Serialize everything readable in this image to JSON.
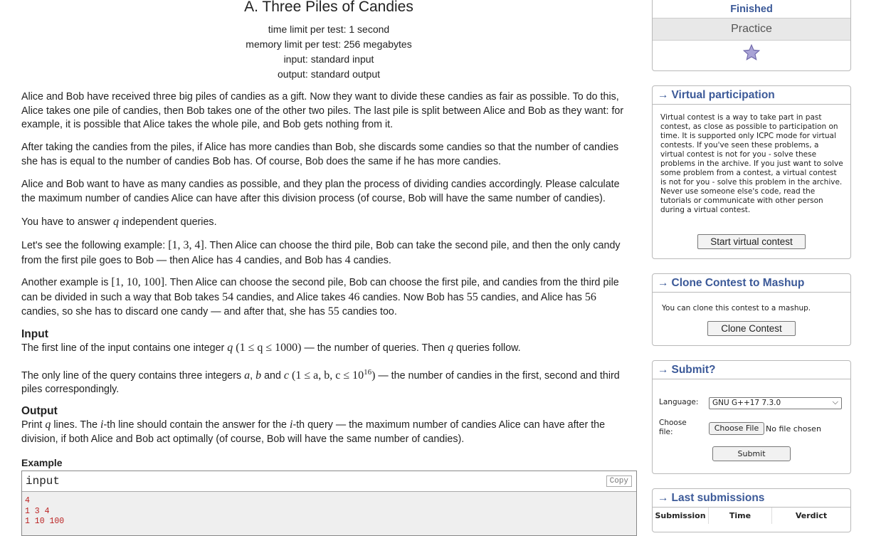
{
  "problem": {
    "title": "A. Three Piles of Candies",
    "limits": [
      "time limit per test: 1 second",
      "memory limit per test: 256 megabytes",
      "input: standard input",
      "output: standard output"
    ],
    "statement": {
      "p1": "Alice and Bob have received three big piles of candies as a gift. Now they want to divide these candies as fair as possible. To do this, Alice takes one pile of candies, then Bob takes one of the other two piles. The last pile is split between Alice and Bob as they want: for example, it is possible that Alice takes the whole pile, and Bob gets nothing from it.",
      "p2": "After taking the candies from the piles, if Alice has more candies than Bob, she discards some candies so that the number of candies she has is equal to the number of candies Bob has. Of course, Bob does the same if he has more candies.",
      "p3": "Alice and Bob want to have as many candies as possible, and they plan the process of dividing candies accordingly. Please calculate the maximum number of candies Alice can have after this division process (of course, Bob will have the same number of candies).",
      "p4_a": "You have to answer ",
      "p4_q": "q",
      "p4_b": " independent queries.",
      "p5_a": "Let's see the following example: ",
      "p5_m1": "[1, 3, 4]",
      "p5_b": ". Then Alice can choose the third pile, Bob can take the second pile, and then the only candy from the first pile goes to Bob — then Alice has ",
      "p5_m2": "4",
      "p5_c": " candies, and Bob has ",
      "p5_m3": "4",
      "p5_d": " candies.",
      "p6_a": "Another example is ",
      "p6_m1": "[1, 10, 100]",
      "p6_b": ". Then Alice can choose the second pile, Bob can choose the first pile, and candies from the third pile can be divided in such a way that Bob takes ",
      "p6_m2": "54",
      "p6_c": " candies, and Alice takes ",
      "p6_m3": "46",
      "p6_d": " candies. Now Bob has ",
      "p6_m4": "55",
      "p6_e": " candies, and Alice has ",
      "p6_m5": "56",
      "p6_f": " candies, so she has to discard one candy — and after that, she has ",
      "p6_m6": "55",
      "p6_g": " candies too."
    },
    "input": {
      "title": "Input",
      "l1_a": "The first line of the input contains one integer ",
      "l1_q": "q",
      "l1_m": "(1 ≤ q ≤ 1000)",
      "l1_b": " — the number of queries. Then ",
      "l1_q2": "q",
      "l1_c": " queries follow.",
      "l2_a": "The only line of the query contains three integers ",
      "l2_va": "a",
      "l2_sep1": ", ",
      "l2_vb": "b",
      "l2_and": " and ",
      "l2_vc": "c",
      "l2_m": "(1 ≤ a, b, c ≤ 10",
      "l2_exp": "16",
      "l2_close": ")",
      "l2_b": " — the number of candies in the first, second and third piles correspondingly."
    },
    "output": {
      "title": "Output",
      "a": "Print ",
      "q": "q",
      "b": " lines. The ",
      "i1": "i",
      "c": "-th line should contain the answer for the ",
      "i2": "i",
      "d": "-th query — the maximum number of candies Alice can have after the division, if both Alice and Bob act optimally (of course, Bob will have the same number of candies)."
    },
    "example": {
      "title": "Example",
      "input_label": "input",
      "copy_label": "Copy",
      "lines": [
        "4",
        "1 3 4",
        "1 10 100"
      ]
    }
  },
  "sidebar": {
    "status": {
      "finished": "Finished",
      "practice": "Practice"
    },
    "virtual": {
      "title": "Virtual participation",
      "text": "Virtual contest is a way to take part in past contest, as close as possible to participation on time. It is supported only ICPC mode for virtual contests. If you've seen these problems, a virtual contest is not for you - solve these problems in the archive. If you just want to solve some problem from a contest, a virtual contest is not for you - solve this problem in the archive. Never use someone else's code, read the tutorials or communicate with other person during a virtual contest.",
      "button": "Start virtual contest"
    },
    "clone": {
      "title": "Clone Contest to Mashup",
      "text": "You can clone this contest to a mashup.",
      "button": "Clone Contest"
    },
    "submit": {
      "title": "Submit?",
      "language_label": "Language:",
      "language_value": "GNU G++17 7.3.0",
      "file_label": "Choose file:",
      "file_button": "Choose File",
      "file_status": "No file chosen",
      "submit_button": "Submit"
    },
    "last": {
      "title": "Last submissions",
      "columns": [
        "Submission",
        "Time",
        "Verdict"
      ]
    },
    "arrow": "→"
  },
  "colors": {
    "accent": "#3b5998",
    "example_text": "#b22222"
  },
  "icons": {
    "star": "star-icon"
  }
}
